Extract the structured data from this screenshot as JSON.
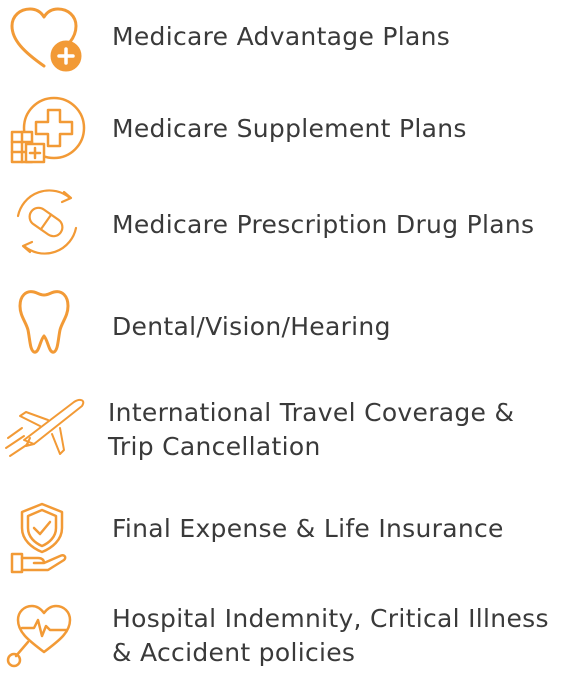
{
  "accent_color": "#F29A36",
  "services": [
    {
      "icon": "heart-plus-icon",
      "label": "Medicare Advantage Plans"
    },
    {
      "icon": "medical-plus-icon",
      "label": "Medicare Supplement Plans"
    },
    {
      "icon": "pill-refill-icon",
      "label": "Medicare Prescription Drug Plans"
    },
    {
      "icon": "tooth-icon",
      "label": "Dental/Vision/Hearing"
    },
    {
      "icon": "airplane-icon",
      "label": "International Travel Coverage & Trip Cancellation"
    },
    {
      "icon": "shield-hand-icon",
      "label": "Final Expense & Life Insurance"
    },
    {
      "icon": "heartbeat-stethoscope-icon",
      "label": "Hospital Indemnity, Critical Illness & Accident policies"
    }
  ]
}
